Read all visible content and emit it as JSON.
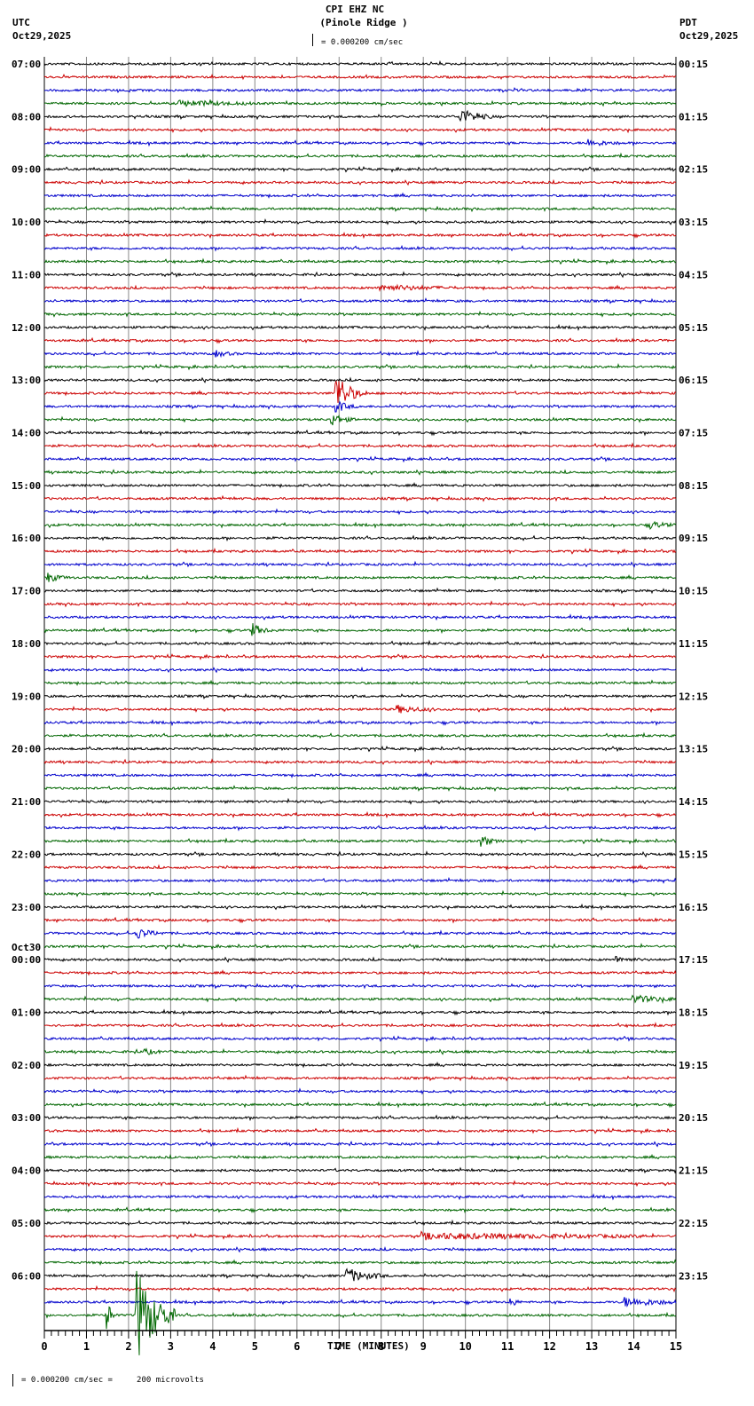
{
  "header": {
    "title": "CPI EHZ NC",
    "subtitle": "(Pinole Ridge )",
    "left_tz": "UTC",
    "left_date": "Oct29,2025",
    "right_tz": "PDT",
    "right_date": "Oct29,2025",
    "scale_text": "= 0.000200 cm/sec"
  },
  "footer": {
    "scale_text": "= 0.000200 cm/sec =     200 microvolts"
  },
  "chart_data": {
    "type": "line",
    "title": "CPI EHZ NC (Pinole Ridge )",
    "xlabel": "TIME (MINUTES)",
    "xlim": [
      0,
      15
    ],
    "x_ticks": [
      "0",
      "1",
      "2",
      "3",
      "4",
      "5",
      "6",
      "7",
      "8",
      "9",
      "10",
      "11",
      "12",
      "13",
      "14",
      "15"
    ],
    "traces_per_hour": 4,
    "trace_count": 96,
    "trace_colors": [
      "#000000",
      "#cc0000",
      "#0000cc",
      "#006600"
    ],
    "day_change_label": "Oct30",
    "day_change_row": 68,
    "left_labels": [
      "07:00",
      "08:00",
      "09:00",
      "10:00",
      "11:00",
      "12:00",
      "13:00",
      "14:00",
      "15:00",
      "16:00",
      "17:00",
      "18:00",
      "19:00",
      "20:00",
      "21:00",
      "22:00",
      "23:00",
      "00:00",
      "01:00",
      "02:00",
      "03:00",
      "04:00",
      "05:00",
      "06:00"
    ],
    "right_labels": [
      "00:15",
      "01:15",
      "02:15",
      "03:15",
      "04:15",
      "05:15",
      "06:15",
      "07:15",
      "08:15",
      "09:15",
      "10:15",
      "11:15",
      "12:15",
      "13:15",
      "14:15",
      "15:15",
      "16:15",
      "17:15",
      "18:15",
      "19:15",
      "20:15",
      "21:15",
      "22:15",
      "23:15"
    ],
    "events": [
      {
        "trace": 3,
        "minute": 3.2,
        "amp": 3,
        "dur": 1.5
      },
      {
        "trace": 4,
        "minute": 9.9,
        "amp": 8,
        "dur": 0.5
      },
      {
        "trace": 6,
        "minute": 12.9,
        "amp": 4,
        "dur": 0.5
      },
      {
        "trace": 17,
        "minute": 8.0,
        "amp": 3,
        "dur": 1.5
      },
      {
        "trace": 22,
        "minute": 4.1,
        "amp": 3,
        "dur": 0.3
      },
      {
        "trace": 25,
        "minute": 6.95,
        "amp": 22,
        "dur": 0.4
      },
      {
        "trace": 26,
        "minute": 6.95,
        "amp": 6,
        "dur": 0.3
      },
      {
        "trace": 27,
        "minute": 6.85,
        "amp": 7,
        "dur": 0.3
      },
      {
        "trace": 35,
        "minute": 14.4,
        "amp": 4,
        "dur": 0.4
      },
      {
        "trace": 39,
        "minute": 0.1,
        "amp": 5,
        "dur": 0.3
      },
      {
        "trace": 43,
        "minute": 4.95,
        "amp": 7,
        "dur": 0.3
      },
      {
        "trace": 49,
        "minute": 8.4,
        "amp": 4,
        "dur": 0.6
      },
      {
        "trace": 59,
        "minute": 10.4,
        "amp": 7,
        "dur": 0.2
      },
      {
        "trace": 66,
        "minute": 2.2,
        "amp": 6,
        "dur": 0.4
      },
      {
        "trace": 68,
        "minute": 13.6,
        "amp": 3,
        "dur": 0.4
      },
      {
        "trace": 71,
        "minute": 14.0,
        "amp": 4,
        "dur": 0.8
      },
      {
        "trace": 75,
        "minute": 2.4,
        "amp": 3,
        "dur": 0.3
      },
      {
        "trace": 89,
        "minute": 9.0,
        "amp": 3,
        "dur": 5.0
      },
      {
        "trace": 92,
        "minute": 7.2,
        "amp": 8,
        "dur": 0.6
      },
      {
        "trace": 94,
        "minute": 11.1,
        "amp": 8,
        "dur": 0.1
      },
      {
        "trace": 94,
        "minute": 13.8,
        "amp": 5,
        "dur": 1.0
      },
      {
        "trace": 95,
        "minute": 1.5,
        "amp": 18,
        "dur": 0.1
      },
      {
        "trace": 95,
        "minute": 2.2,
        "amp": 55,
        "dur": 0.6
      }
    ]
  }
}
